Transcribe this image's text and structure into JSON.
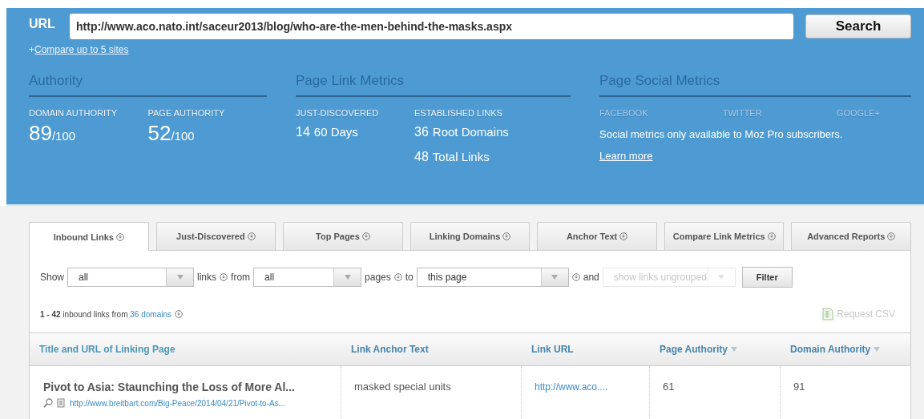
{
  "search_bar": {
    "label": "URL",
    "value": "http://www.aco.nato.int/saceur2013/blog/who-are-the-men-behind-the-masks.aspx",
    "button": "Search",
    "compare_prefix": "+",
    "compare_link": "Compare up to 5 sites"
  },
  "authority": {
    "title": "Authority",
    "metrics": [
      {
        "label": "DOMAIN AUTHORITY",
        "value": "89",
        "suffix": "/100"
      },
      {
        "label": "PAGE AUTHORITY",
        "value": "52",
        "suffix": "/100"
      }
    ]
  },
  "page_link_metrics": {
    "title": "Page Link Metrics",
    "columns": [
      {
        "label": "JUST-DISCOVERED",
        "stats": [
          {
            "number": "14",
            "text": "60 Days"
          }
        ]
      },
      {
        "label": "ESTABLISHED LINKS",
        "stats": [
          {
            "number": "36",
            "text": "Root Domains"
          },
          {
            "number": "48",
            "text": "Total Links"
          }
        ]
      }
    ]
  },
  "page_social_metrics": {
    "title": "Page Social Metrics",
    "networks": [
      "FACEBOOK",
      "TWITTER",
      "GOOGLE+"
    ],
    "message": "Social metrics only available to Moz Pro subscribers.",
    "link": "Learn more"
  },
  "tabs": [
    {
      "label": "Inbound Links",
      "selected": true
    },
    {
      "label": "Just-Discovered",
      "selected": false
    },
    {
      "label": "Top Pages",
      "selected": false
    },
    {
      "label": "Linking Domains",
      "selected": false
    },
    {
      "label": "Anchor Text",
      "selected": false
    },
    {
      "label": "Compare Link Metrics",
      "selected": false
    },
    {
      "label": "Advanced Reports",
      "selected": false
    }
  ],
  "filter": {
    "parts": [
      {
        "kind": "text",
        "text": "Show"
      },
      {
        "kind": "select",
        "value": "all",
        "disabled": false
      },
      {
        "kind": "text",
        "text": "links"
      },
      {
        "kind": "info"
      },
      {
        "kind": "text",
        "text": "from"
      },
      {
        "kind": "select",
        "value": "all",
        "disabled": false
      },
      {
        "kind": "text",
        "text": "pages"
      },
      {
        "kind": "info"
      },
      {
        "kind": "text",
        "text": "to"
      },
      {
        "kind": "select",
        "value": "this page",
        "disabled": false
      },
      {
        "kind": "info"
      },
      {
        "kind": "text",
        "text": "and"
      },
      {
        "kind": "select",
        "value": "show links ungrouped",
        "disabled": true
      }
    ],
    "button": "Filter"
  },
  "summary": {
    "text": "**1 - 42** inbound links from",
    "link": "36 domains"
  },
  "csv_button": {
    "label": "Request CSV",
    "disabled": true
  },
  "table": {
    "columns": [
      {
        "label": "Title and URL of Linking Page",
        "sortable": false
      },
      {
        "label": "Link Anchor Text",
        "sortable": false
      },
      {
        "label": "Link URL",
        "sortable": false
      },
      {
        "label": "Page Authority",
        "sortable": true
      },
      {
        "label": "Domain Authority",
        "sortable": true
      }
    ],
    "rows": [
      {
        "title": "Pivot to Asia: Staunching the Loss of More Al...",
        "url": "http://www.breitbart.com/Big-Peace/2014/04/21/Pivot-to-As...",
        "anchor_text": "masked special units",
        "link_url": "http://www.aco....",
        "page_authority": "61",
        "domain_authority": "91"
      }
    ]
  }
}
